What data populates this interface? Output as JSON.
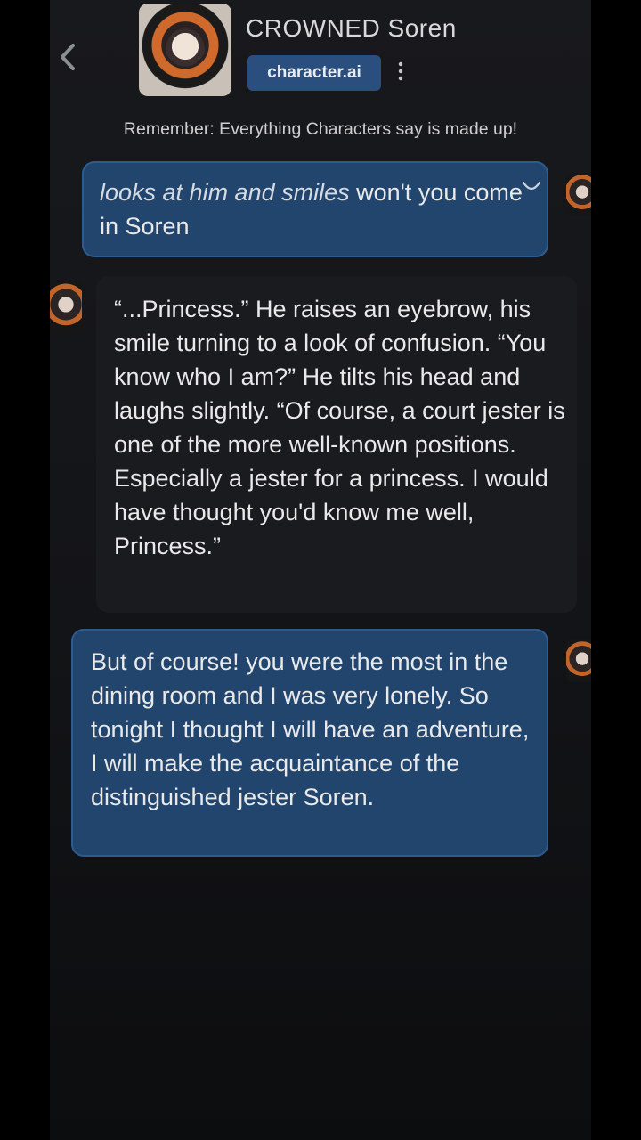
{
  "header": {
    "character_name": "CROWNED Soren",
    "badge": "character.ai",
    "icons": {
      "back": "chevron-left-icon",
      "more": "more-vertical-icon"
    }
  },
  "disclaimer": "Remember: Everything Characters say is made up!",
  "messages": [
    {
      "role": "user",
      "action_text": "looks at him and smiles",
      "text": " won't you come in Soren"
    },
    {
      "role": "character",
      "text": "“...Princess.” He raises an eyebrow, his smile turning to a look of confusion. “You know who I am?” He tilts his head and laughs slightly. “Of course, a court jester is one of the more well-known positions. Especially a jester for a princess. I would have thought you'd know me well, Princess.”"
    },
    {
      "role": "user",
      "text": "But of course! you were the most in the dining room and I was very lonely. So tonight I thought I will have an adventure, I will make the acquaintance of the distinguished jester Soren."
    }
  ],
  "colors": {
    "background": "#131417",
    "user_bubble": "#22456e",
    "char_bubble": "#1a1b1f",
    "badge": "#2a4e7e",
    "text": "#e9e9e9"
  }
}
